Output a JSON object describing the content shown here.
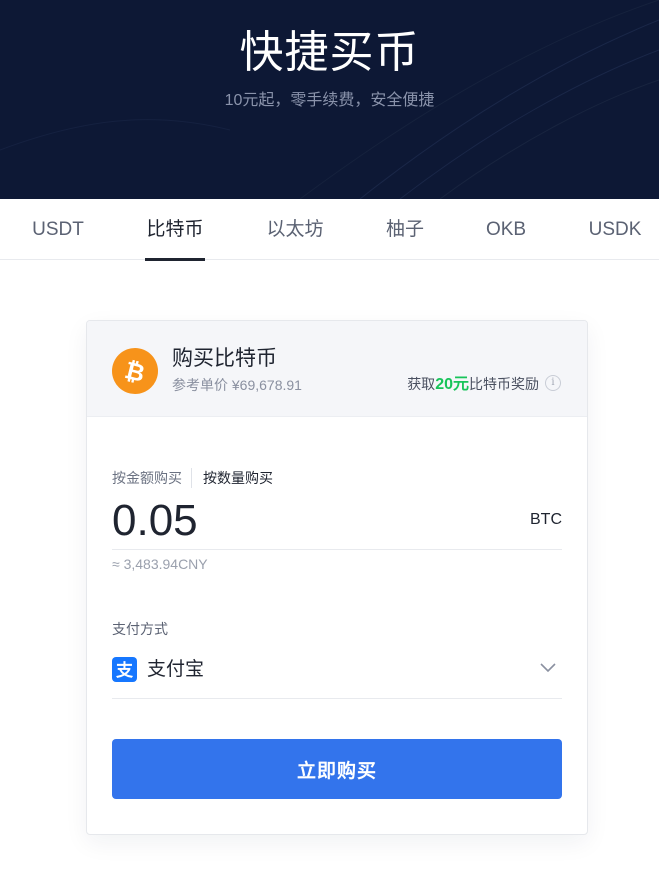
{
  "banner": {
    "title": "快捷买币",
    "subtitle": "10元起，零手续费，安全便捷"
  },
  "tabs": [
    {
      "label": "USDT",
      "active": false
    },
    {
      "label": "比特币",
      "active": true
    },
    {
      "label": "以太坊",
      "active": false
    },
    {
      "label": "柚子",
      "active": false
    },
    {
      "label": "OKB",
      "active": false
    },
    {
      "label": "USDK",
      "active": false
    }
  ],
  "card": {
    "title": "购买比特币",
    "reference_price": "参考单价 ¥69,678.91",
    "reward": {
      "prefix": "获取",
      "amount": "20元",
      "suffix": "比特币奖励"
    },
    "info_symbol": "i",
    "coin_icon": "bitcoin-icon"
  },
  "order": {
    "mode_amount": "按金额购买",
    "mode_quantity": "按数量购买",
    "selected_mode": "quantity",
    "value": "0.05",
    "unit": "BTC",
    "converted": "≈ 3,483.94CNY"
  },
  "payment": {
    "label": "支付方式",
    "method": "支付宝",
    "method_icon": "alipay-icon"
  },
  "buy_button": "立即购买",
  "colors": {
    "banner_bg": "#0d1835",
    "bitcoin_orange": "#f7931a",
    "reward_green": "#18c45a",
    "primary_blue": "#3374ec",
    "alipay_blue": "#1677ff"
  }
}
